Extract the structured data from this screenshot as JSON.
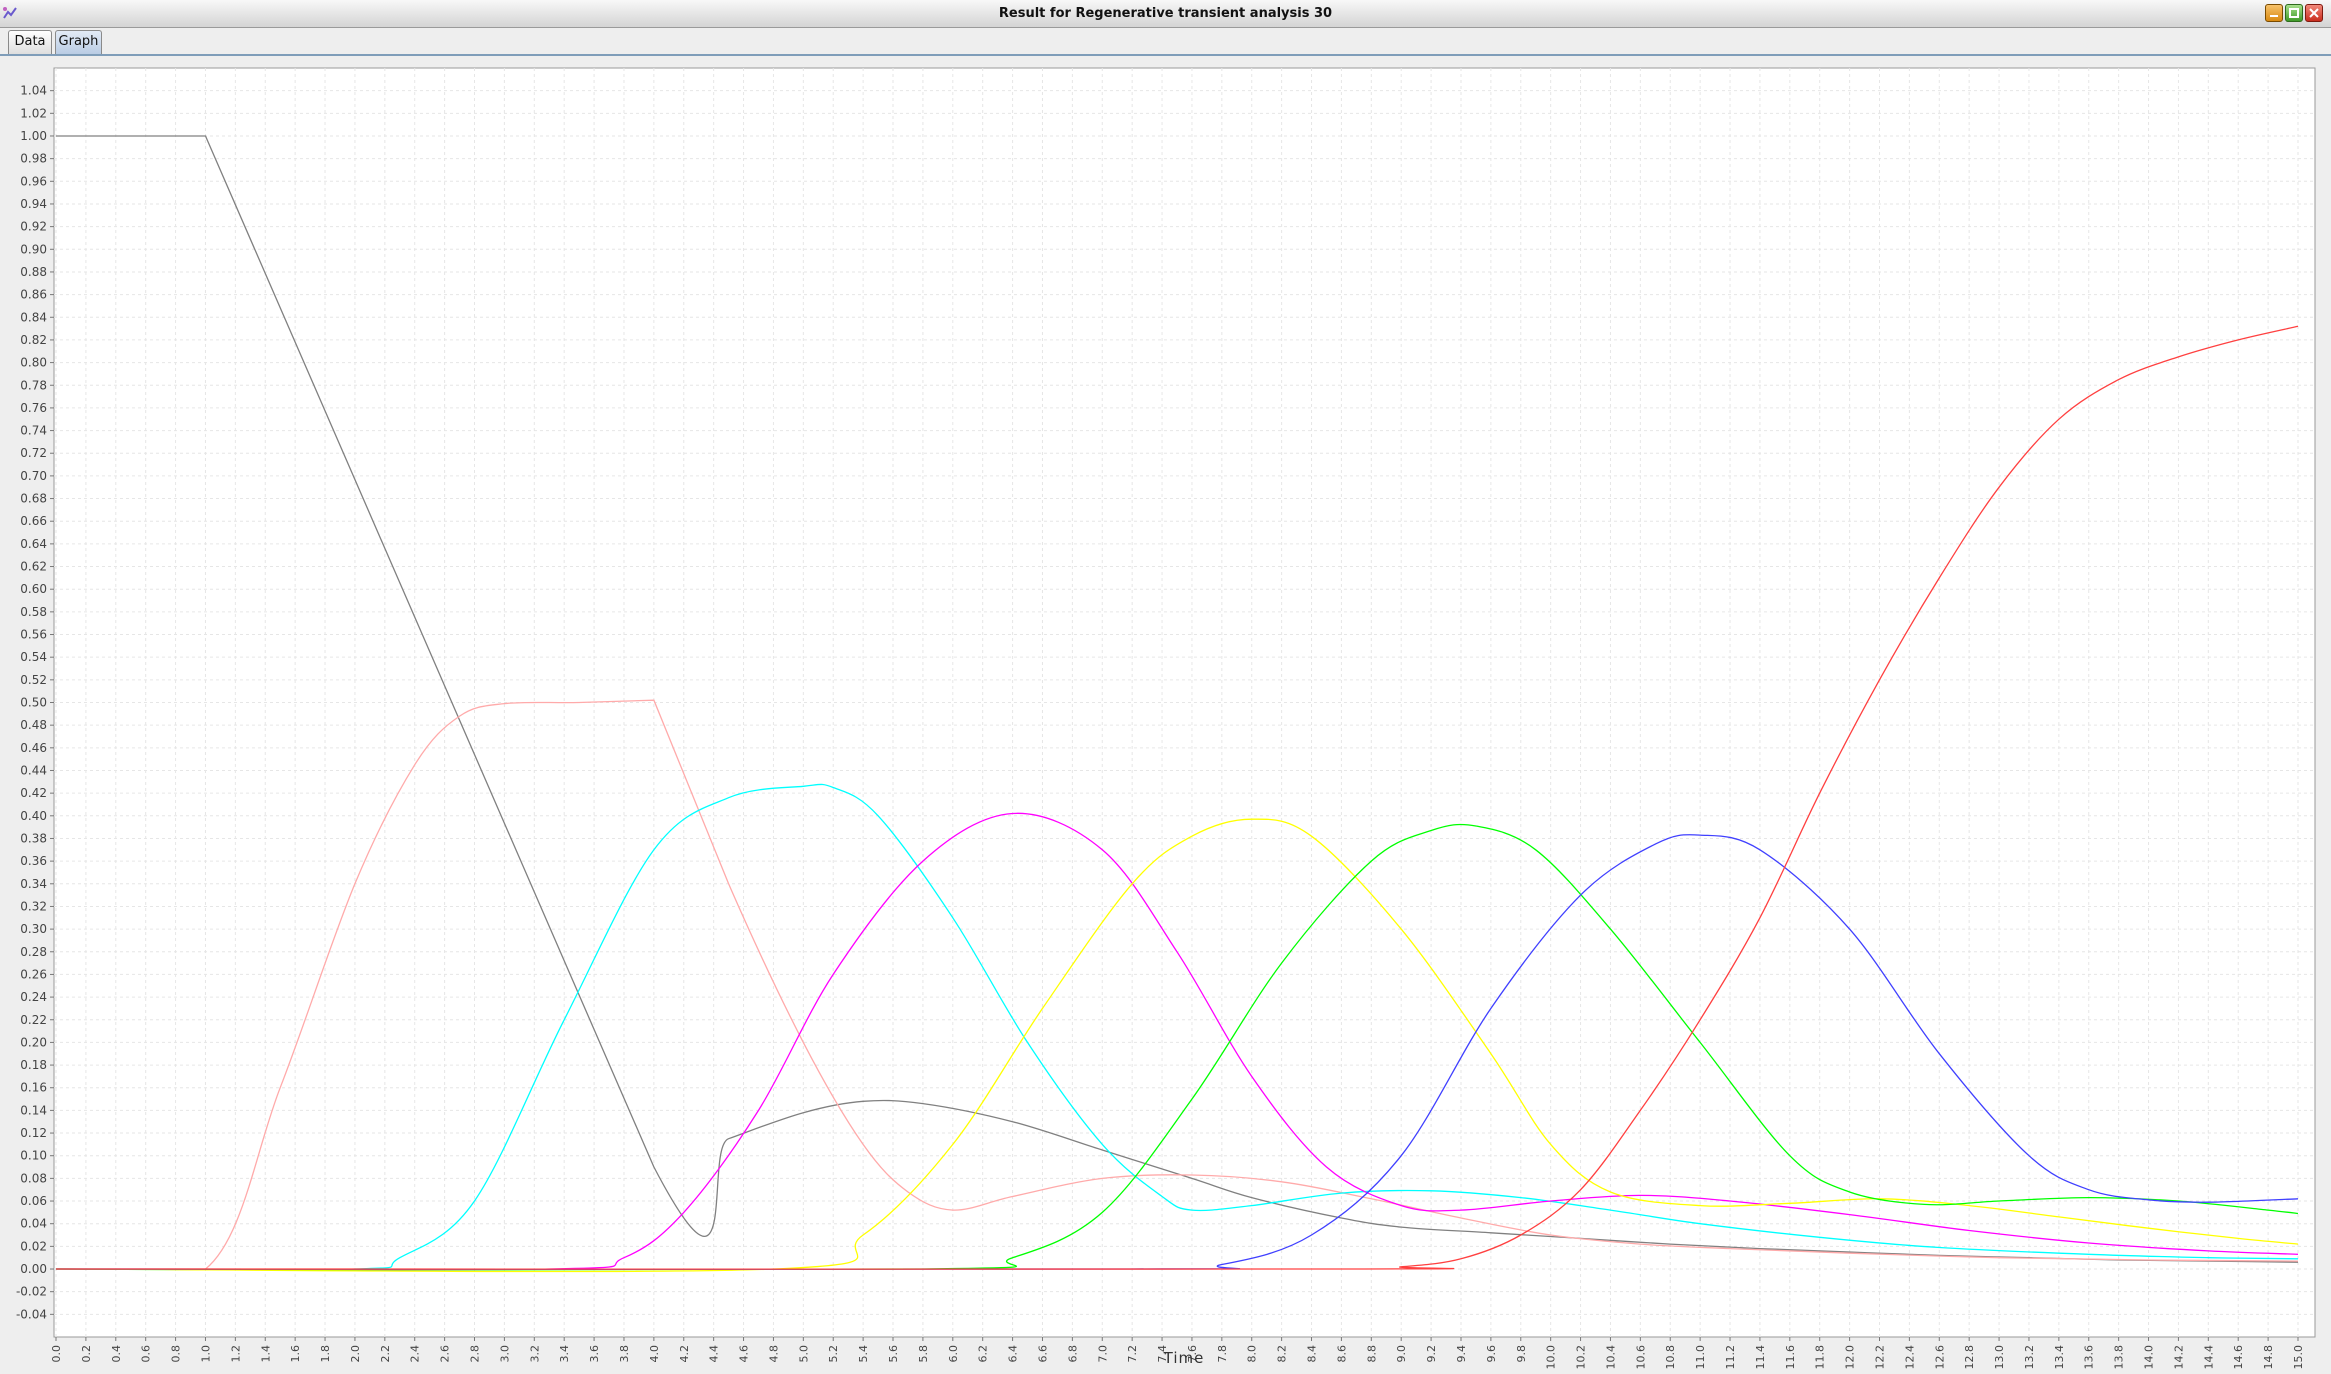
{
  "window": {
    "title": "Result for Regenerative transient analysis 30"
  },
  "tabs": [
    {
      "label": "Data"
    },
    {
      "label": "Graph"
    }
  ],
  "icons": {
    "app": "app-icon",
    "minimize": "minimize-icon",
    "maximize": "maximize-icon",
    "close": "close-icon"
  },
  "chart_data": {
    "type": "line",
    "title": "",
    "xlabel": "Time",
    "ylabel": "",
    "xlim": [
      0,
      15
    ],
    "ylim": [
      -0.06,
      1.06
    ],
    "x_ticks": [
      "0.0",
      "0.2",
      "0.4",
      "0.6",
      "0.8",
      "1.0",
      "1.2",
      "1.4",
      "1.6",
      "1.8",
      "2.0",
      "2.2",
      "2.4",
      "2.6",
      "2.8",
      "3.0",
      "3.2",
      "3.4",
      "3.6",
      "3.8",
      "4.0",
      "4.2",
      "4.4",
      "4.6",
      "4.8",
      "5.0",
      "5.2",
      "5.4",
      "5.6",
      "5.8",
      "6.0",
      "6.2",
      "6.4",
      "6.6",
      "6.8",
      "7.0",
      "7.2",
      "7.4",
      "7.6",
      "7.8",
      "8.0",
      "8.2",
      "8.4",
      "8.6",
      "8.8",
      "9.0",
      "9.2",
      "9.4",
      "9.6",
      "9.8",
      "10.0",
      "10.2",
      "10.4",
      "10.6",
      "10.8",
      "11.0",
      "11.2",
      "11.4",
      "11.6",
      "11.8",
      "12.0",
      "12.2",
      "12.4",
      "12.6",
      "12.8",
      "13.0",
      "13.2",
      "13.4",
      "13.6",
      "13.8",
      "14.0",
      "14.2",
      "14.4",
      "14.6",
      "14.8",
      "15.0"
    ],
    "y_ticks": [
      "1.04",
      "1.02",
      "1.00",
      "0.98",
      "0.96",
      "0.94",
      "0.92",
      "0.90",
      "0.88",
      "0.86",
      "0.84",
      "0.82",
      "0.80",
      "0.78",
      "0.76",
      "0.74",
      "0.72",
      "0.70",
      "0.68",
      "0.66",
      "0.64",
      "0.62",
      "0.60",
      "0.58",
      "0.56",
      "0.54",
      "0.52",
      "0.50",
      "0.48",
      "0.46",
      "0.44",
      "0.42",
      "0.40",
      "0.38",
      "0.36",
      "0.34",
      "0.32",
      "0.30",
      "0.28",
      "0.26",
      "0.24",
      "0.22",
      "0.20",
      "0.18",
      "0.16",
      "0.14",
      "0.12",
      "0.10",
      "0.08",
      "0.06",
      "0.04",
      "0.02",
      "0.00",
      "-0.02",
      "-0.04"
    ],
    "grid": true,
    "legend": "none",
    "series": [
      {
        "color": "#808080",
        "x": [
          0,
          1.0,
          4.0,
          4.5,
          5.0,
          5.4,
          5.8,
          6.4,
          7.0,
          7.6,
          8.0,
          8.6,
          9.0,
          9.6,
          10.2,
          10.8,
          11.4,
          12.0,
          12.6,
          13.2,
          13.8,
          14.4,
          15.0
        ],
        "values": [
          1.0,
          1.0,
          0.09,
          0.115,
          0.138,
          0.148,
          0.146,
          0.13,
          0.105,
          0.08,
          0.063,
          0.045,
          0.037,
          0.032,
          0.027,
          0.022,
          0.018,
          0.015,
          0.012,
          0.01,
          0.008,
          0.007,
          0.006
        ]
      },
      {
        "color": "#ffaaaa",
        "x": [
          0,
          1.0,
          1.5,
          2.0,
          2.4,
          2.7,
          3.0,
          3.5,
          4.0,
          4.5,
          5.0,
          5.4,
          5.7,
          6.0,
          6.4,
          7.0,
          7.6,
          8.2,
          8.8,
          9.4,
          10.0,
          10.6,
          11.2,
          12.0,
          13.0,
          14.0,
          15.0
        ],
        "values": [
          0,
          0,
          0.16,
          0.34,
          0.445,
          0.488,
          0.499,
          0.5,
          0.502,
          0.34,
          0.2,
          0.11,
          0.068,
          0.052,
          0.064,
          0.08,
          0.083,
          0.077,
          0.062,
          0.045,
          0.03,
          0.022,
          0.018,
          0.014,
          0.01,
          0.008,
          0.007
        ]
      },
      {
        "color": "#00ffff",
        "x": [
          0,
          2.0,
          2.3,
          2.8,
          3.4,
          4.0,
          4.5,
          5.0,
          5.2,
          5.5,
          6.0,
          6.5,
          7.0,
          7.4,
          7.6,
          8.0,
          8.6,
          9.2,
          9.8,
          10.4,
          11.0,
          11.8,
          12.6,
          13.6,
          14.4,
          15.0
        ],
        "values": [
          0,
          0,
          0.01,
          0.06,
          0.22,
          0.37,
          0.416,
          0.426,
          0.425,
          0.4,
          0.31,
          0.2,
          0.11,
          0.064,
          0.052,
          0.056,
          0.067,
          0.069,
          0.063,
          0.052,
          0.04,
          0.028,
          0.019,
          0.013,
          0.01,
          0.009
        ]
      },
      {
        "color": "#ff00ff",
        "x": [
          0,
          3.3,
          3.8,
          4.2,
          4.7,
          5.2,
          5.8,
          6.4,
          7.0,
          7.5,
          8.0,
          8.5,
          9.0,
          9.4,
          10.0,
          10.6,
          11.2,
          12.0,
          12.8,
          13.6,
          14.4,
          15.0
        ],
        "values": [
          0,
          0,
          0.01,
          0.05,
          0.14,
          0.26,
          0.36,
          0.402,
          0.37,
          0.28,
          0.17,
          0.09,
          0.056,
          0.052,
          0.06,
          0.065,
          0.06,
          0.048,
          0.034,
          0.023,
          0.016,
          0.013
        ]
      },
      {
        "color": "#ffff00",
        "x": [
          0,
          4.8,
          5.4,
          6.0,
          6.6,
          7.2,
          7.6,
          8.0,
          8.4,
          9.0,
          9.6,
          10.0,
          10.4,
          11.0,
          11.6,
          12.2,
          12.8,
          13.4,
          14.0,
          14.6,
          15.0
        ],
        "values": [
          0,
          0,
          0.03,
          0.11,
          0.23,
          0.34,
          0.382,
          0.397,
          0.382,
          0.3,
          0.19,
          0.11,
          0.068,
          0.056,
          0.058,
          0.062,
          0.056,
          0.046,
          0.036,
          0.027,
          0.022
        ]
      },
      {
        "color": "#00ff00",
        "x": [
          0,
          5.8,
          6.4,
          7.0,
          7.6,
          8.2,
          8.8,
          9.2,
          9.5,
          9.9,
          10.4,
          11.0,
          11.6,
          12.0,
          12.5,
          13.0,
          13.6,
          14.2,
          14.8,
          15.0
        ],
        "values": [
          0,
          0,
          0.01,
          0.05,
          0.15,
          0.27,
          0.36,
          0.387,
          0.391,
          0.37,
          0.3,
          0.2,
          0.1,
          0.068,
          0.057,
          0.06,
          0.063,
          0.06,
          0.052,
          0.049
        ]
      },
      {
        "color": "#4040ff",
        "x": [
          0,
          7.2,
          7.8,
          8.4,
          9.0,
          9.6,
          10.2,
          10.7,
          11.0,
          11.4,
          12.0,
          12.6,
          13.2,
          13.6,
          14.0,
          14.4,
          15.0
        ],
        "values": [
          0,
          0,
          0.004,
          0.03,
          0.1,
          0.23,
          0.33,
          0.375,
          0.383,
          0.37,
          0.3,
          0.19,
          0.1,
          0.07,
          0.061,
          0.059,
          0.062
        ]
      },
      {
        "color": "#ff4040",
        "x": [
          0,
          8.6,
          9.0,
          9.4,
          9.8,
          10.2,
          10.6,
          11.0,
          11.4,
          11.8,
          12.2,
          12.6,
          13.0,
          13.4,
          13.8,
          14.2,
          14.6,
          15.0
        ],
        "values": [
          0,
          0,
          0.002,
          0.009,
          0.03,
          0.07,
          0.14,
          0.22,
          0.31,
          0.42,
          0.52,
          0.61,
          0.69,
          0.75,
          0.785,
          0.805,
          0.82,
          0.832
        ]
      }
    ]
  }
}
